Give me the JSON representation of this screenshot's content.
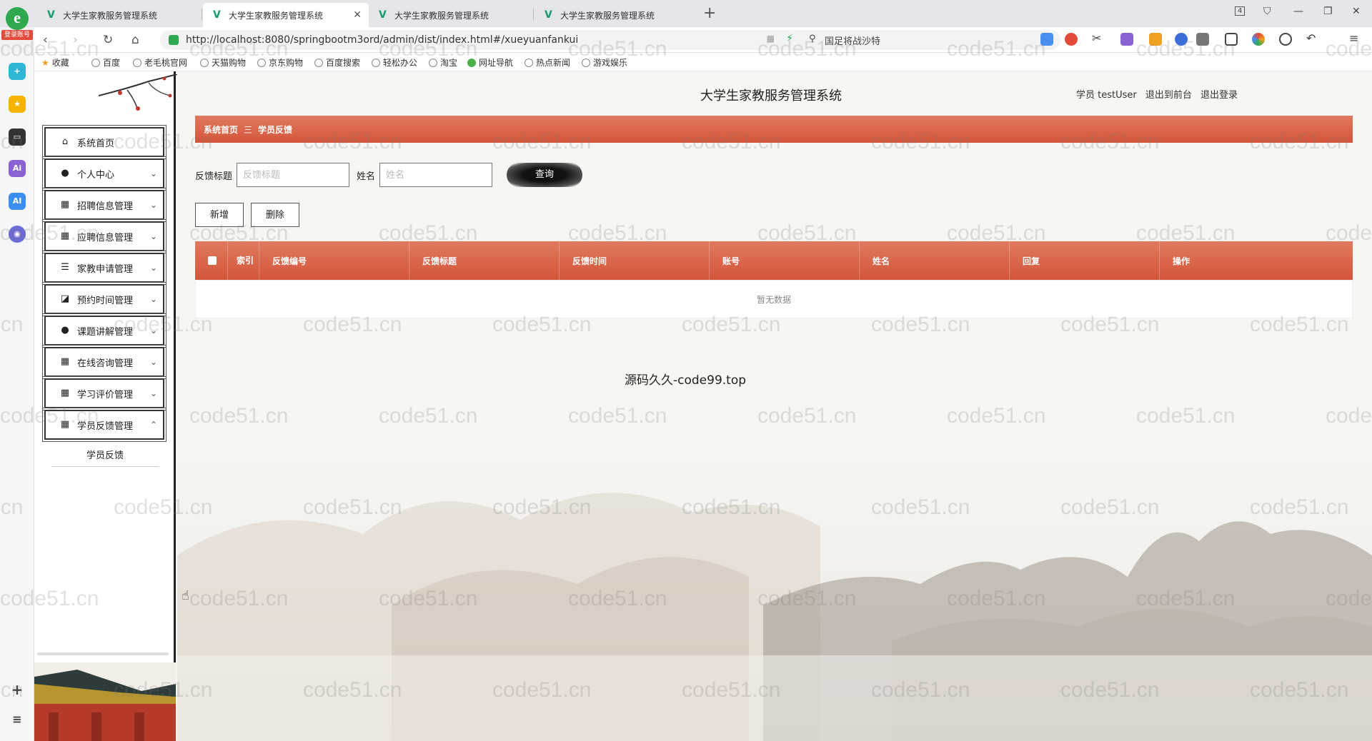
{
  "browser": {
    "tabs": [
      {
        "title": "大学生家教服务管理系统"
      },
      {
        "title": "大学生家教服务管理系统"
      },
      {
        "title": "大学生家教服务管理系统"
      },
      {
        "title": "大学生家教服务管理系统"
      }
    ],
    "login_badge": "登录账号",
    "url": "http://localhost:8080/springbootm3ord/admin/dist/index.html#/xueyuanfankui",
    "search_text": "国足将战沙特",
    "tab_count": "4",
    "bookmarks": [
      "收藏",
      "百度",
      "老毛桃官网",
      "天猫购物",
      "京东购物",
      "百度搜索",
      "轻松办公",
      "淘宝",
      "网址导航",
      "热点新闻",
      "游戏娱乐"
    ]
  },
  "app": {
    "title": "大学生家教服务管理系统",
    "user": {
      "role_name": "学员 testUser",
      "back_to_front": "退出到前台",
      "logout": "退出登录"
    },
    "menu": [
      {
        "label": "系统首页",
        "icon": "home-icon"
      },
      {
        "label": "个人中心",
        "icon": "user-icon"
      },
      {
        "label": "招聘信息管理",
        "icon": "grid-icon"
      },
      {
        "label": "应聘信息管理",
        "icon": "grid-icon"
      },
      {
        "label": "家教申请管理",
        "icon": "list-icon"
      },
      {
        "label": "预约时间管理",
        "icon": "chart-icon"
      },
      {
        "label": "课题讲解管理",
        "icon": "user-icon"
      },
      {
        "label": "在线咨询管理",
        "icon": "grid-icon"
      },
      {
        "label": "学习评价管理",
        "icon": "grid-icon"
      },
      {
        "label": "学员反馈管理",
        "icon": "grid-icon"
      }
    ],
    "submenu_item": "学员反馈",
    "breadcrumb": {
      "home": "系统首页",
      "separator": "三",
      "current": "学员反馈"
    },
    "filter": {
      "title_label": "反馈标题",
      "title_placeholder": "反馈标题",
      "name_label": "姓名",
      "name_placeholder": "姓名",
      "query_button": "查询"
    },
    "actions": {
      "add": "新增",
      "delete": "删除"
    },
    "table": {
      "index_header": "索引",
      "columns": [
        "反馈编号",
        "反馈标题",
        "反馈时间",
        "账号",
        "姓名",
        "回复",
        "操作"
      ],
      "empty_text": "暂无数据"
    },
    "center_text": "源码久久-code99.top",
    "watermark": "code51.cn"
  }
}
